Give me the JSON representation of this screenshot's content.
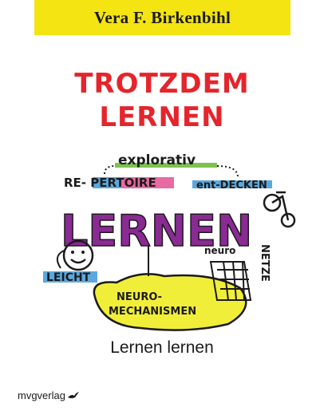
{
  "author": "Vera F. Birkenbihl",
  "title_line1": "TROTZDEM",
  "title_line2": "LERNEN",
  "subtitle": "Lernen lernen",
  "publisher": "mvgverlag",
  "illustration": {
    "explorativ": "explorativ",
    "repertoire": "RE- PERTOIRE",
    "entdecken": "ent-DECKEN",
    "lernen": "LERNEN",
    "neuro": "neuro",
    "netze": "NETZE",
    "leicht": "LEICHT",
    "neuro_mechanismen_1": "NEURO-",
    "neuro_mechanismen_2": "MECHANISMEN",
    "icons": [
      "smiley-icon",
      "bicycle-icon",
      "brain-net-icon"
    ]
  },
  "colors": {
    "author_bar": "#f4e411",
    "title": "#e4252c",
    "lernen_purple": "#8a2a93",
    "lernen_blue": "#2e66c8",
    "lernen_green": "#56b947",
    "blob_yellow": "#f1ee3a",
    "highlight_blue": "#5ba8de",
    "highlight_pink": "#e76aa2",
    "highlight_green": "#7cc34e"
  }
}
